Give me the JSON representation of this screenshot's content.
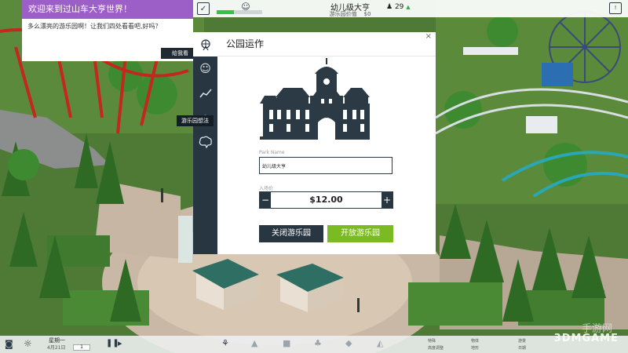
{
  "notification": {
    "title": "欢迎来到过山车大亨世界！",
    "message": "多么漂亮的游乐园啊！让我们四处看看吧,好吗？",
    "button": "给我看"
  },
  "topbar": {
    "park_name": "幼儿级大亨",
    "park_value_label": "游乐园价值",
    "park_value": "$0",
    "guests": "29",
    "rating_fraction": 0.38
  },
  "sidebar": {
    "tooltip": "游乐园想法",
    "icons": [
      "ferris-wheel-icon",
      "smile-icon",
      "chart-icon",
      "lightbulb-icon",
      "brain-icon"
    ]
  },
  "dialog": {
    "title": "公园运作",
    "close": "×",
    "name_label": "Park Name",
    "name_value": "幼儿级大亨",
    "price_label": "入场价",
    "price": "$12.00",
    "minus": "−",
    "plus": "+",
    "close_park": "关闭游乐园",
    "open_park": "开放游乐园"
  },
  "bottombar": {
    "day": "星期一",
    "date": "4月21日",
    "speed": "1",
    "label_a": "特殊",
    "label_b": "游景",
    "label_c": "日期",
    "label_d": "高度调整",
    "label_e": "物体",
    "label_f": "地形"
  },
  "watermark": "3DMGAME",
  "watermark_top": "手游网"
}
